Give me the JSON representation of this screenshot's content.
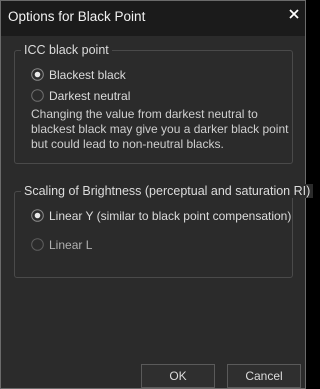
{
  "window": {
    "title": "Options for Black Point",
    "close_glyph": "×"
  },
  "icc_group": {
    "legend": "ICC black point",
    "options": [
      {
        "label": "Blackest black",
        "selected": true
      },
      {
        "label": "Darkest neutral",
        "selected": false
      }
    ],
    "description": "Changing the value from darkest neutral to blackest black may give you a darker black point but could lead to non-neutral blacks."
  },
  "scaling_group": {
    "legend": "Scaling of Brightness (perceptual and saturation RI)",
    "options": [
      {
        "label": "Linear Y (similar to black point compensation)",
        "selected": true
      },
      {
        "label": "Linear L",
        "selected": false
      }
    ]
  },
  "buttons": {
    "ok_label": "OK",
    "cancel_label": "Cancel"
  },
  "colors": {
    "background": "#2b2b2b",
    "titlebar": "#1b1b1b",
    "text": "#dcdcdc",
    "border": "#4a4a4a"
  }
}
